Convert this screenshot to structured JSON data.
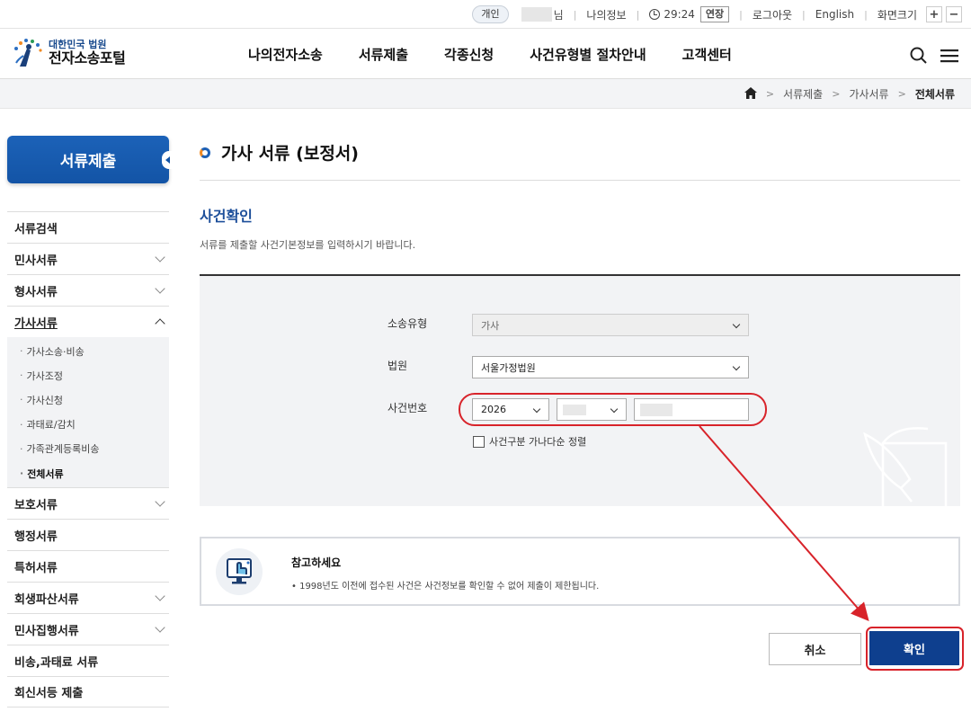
{
  "util": {
    "badge": "개인",
    "user_suffix": "님",
    "my_info": "나의정보",
    "timer": "29:24",
    "extend": "연장",
    "logout": "로그아웃",
    "english": "English",
    "font_size": "화면크기",
    "plus": "+",
    "minus": "−"
  },
  "logo": {
    "small": "대한민국 법원",
    "big": "전자소송포털"
  },
  "gnb": [
    "나의전자소송",
    "서류제출",
    "각종신청",
    "사건유형별 절차안내",
    "고객센터"
  ],
  "breadcrumb": {
    "items": [
      "서류제출",
      "가사서류"
    ],
    "current": "전체서류"
  },
  "side": {
    "header": "서류제출",
    "items": [
      "서류검색",
      "민사서류",
      "형사서류",
      "가사서류"
    ],
    "sub": [
      "가사소송·비송",
      "가사조정",
      "가사신청",
      "과태료/감치",
      "가족관계등록비송",
      "전체서류"
    ],
    "items_after": [
      "보호서류",
      "행정서류",
      "특허서류",
      "회생파산서류",
      "민사집행서류",
      "비송,과태료 서류",
      "회신서등 제출"
    ]
  },
  "page": {
    "title": "가사 서류 (보정서)",
    "section": "사건확인",
    "desc": "서류를 제출할 사건기본정보를 입력하시기 바랍니다."
  },
  "form": {
    "type_label": "소송유형",
    "type_value": "가사",
    "court_label": "법원",
    "court_value": "서울가정법원",
    "case_label": "사건번호",
    "year_value": "2026",
    "sort_label": "사건구분 가나다순 정렬"
  },
  "note": {
    "title": "참고하세요",
    "desc": "• 1998년도 이전에 접수된 사건은 사건정보를 확인할 수 없어 제출이 제한됩니다."
  },
  "buttons": {
    "cancel": "취소",
    "ok": "확인"
  },
  "colors": {
    "brand": "#1354a6",
    "primary_button": "#0e3f8e",
    "annotation": "#d8232a"
  }
}
